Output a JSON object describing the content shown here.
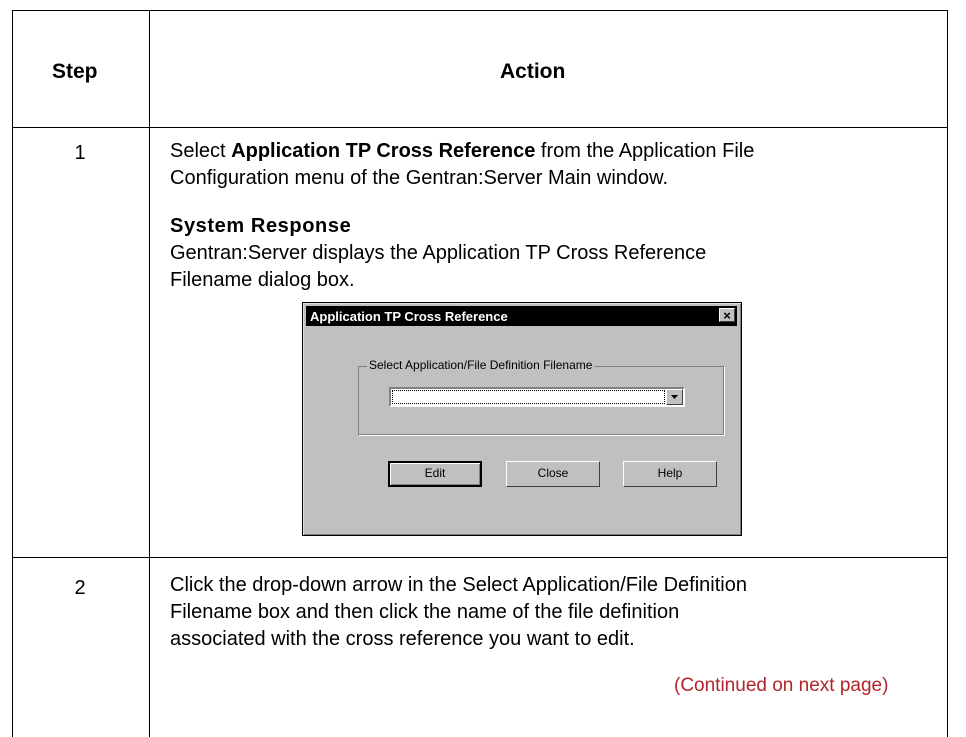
{
  "table": {
    "header": {
      "step": "Step",
      "action": "Action"
    },
    "rows": [
      {
        "step": "1",
        "line1_pre": "Select ",
        "line1_bold": "Application TP Cross Reference",
        "line1_post": " from the Application File",
        "line2": "Configuration menu of the Gentran:Server Main window.",
        "system_response_title": "System Response",
        "sr_line1": "Gentran:Server displays the Application TP Cross Reference",
        "sr_line2": "Filename dialog box."
      },
      {
        "step": "2",
        "line1": "Click the drop-down arrow in the Select Application/File Definition",
        "line2": "Filename box and then click the name of the file definition",
        "line3": "associated with the cross reference you want to edit."
      }
    ],
    "continued": "(Continued on next page)"
  },
  "dialog": {
    "title": "Application TP Cross Reference",
    "close_glyph": "×",
    "group_label": "Select Application/File Definition Filename",
    "combo_value": "",
    "buttons": {
      "edit": "Edit",
      "close": "Close",
      "help": "Help"
    }
  }
}
